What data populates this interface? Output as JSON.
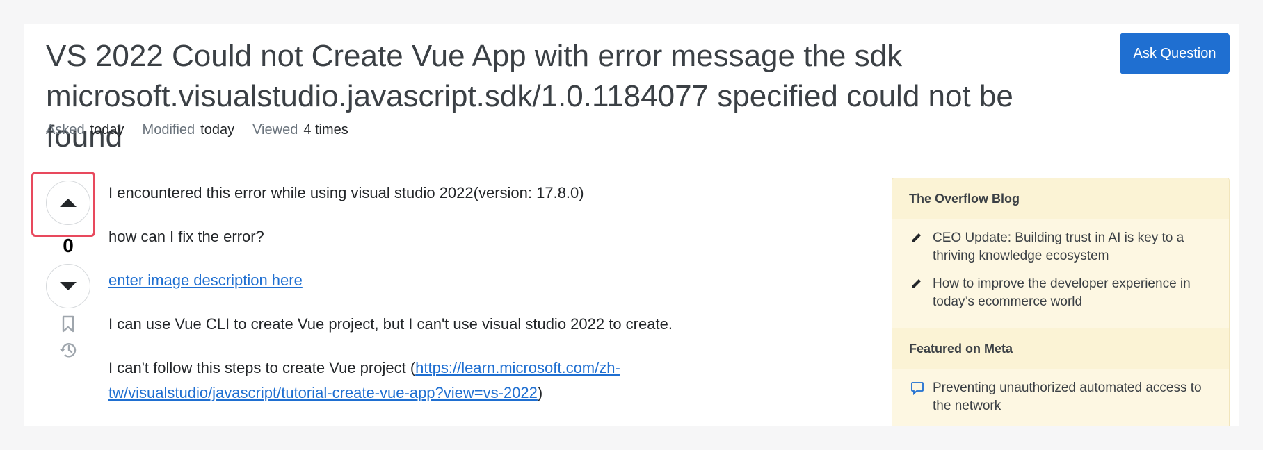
{
  "question": {
    "title": "VS 2022 Could not Create Vue App with error message the sdk microsoft.visualstudio.javascript.sdk/1.0.1184077 specified could not be found",
    "ask_button": "Ask Question",
    "meta": [
      {
        "label": "Asked",
        "value": "today"
      },
      {
        "label": "Modified",
        "value": "today"
      },
      {
        "label": "Viewed",
        "value": "4 times"
      }
    ],
    "vote_count": "0",
    "body": {
      "p1": "I encountered this error while using visual studio 2022(version: 17.8.0)",
      "p2": "how can I fix the error?",
      "image_link": "enter image description here",
      "p4": "I can use Vue CLI to create Vue project, but I can't use visual studio 2022 to create.",
      "p5_prefix": "I can't follow this steps to create Vue project (",
      "p5_link": "https://learn.microsoft.com/zh-tw/visualstudio/javascript/tutorial-create-vue-app?view=vs-2022",
      "p5_suffix": ")"
    }
  },
  "sidebar": {
    "blog_header": "The Overflow Blog",
    "blog_items": [
      {
        "text": "CEO Update: Building trust in AI is key to a thriving knowledge ecosystem",
        "icon": "pencil-icon"
      },
      {
        "text": "How to improve the developer experience in today’s ecommerce world",
        "icon": "pencil-icon"
      }
    ],
    "meta_header": "Featured on Meta",
    "meta_items": [
      {
        "text": "Preventing unauthorized automated access to the network",
        "icon": "speech-bubble-icon"
      }
    ]
  },
  "colors": {
    "accent": "#1f6fd1",
    "highlight": "#e8495d",
    "sidebar_bg": "#fdf7e2"
  }
}
